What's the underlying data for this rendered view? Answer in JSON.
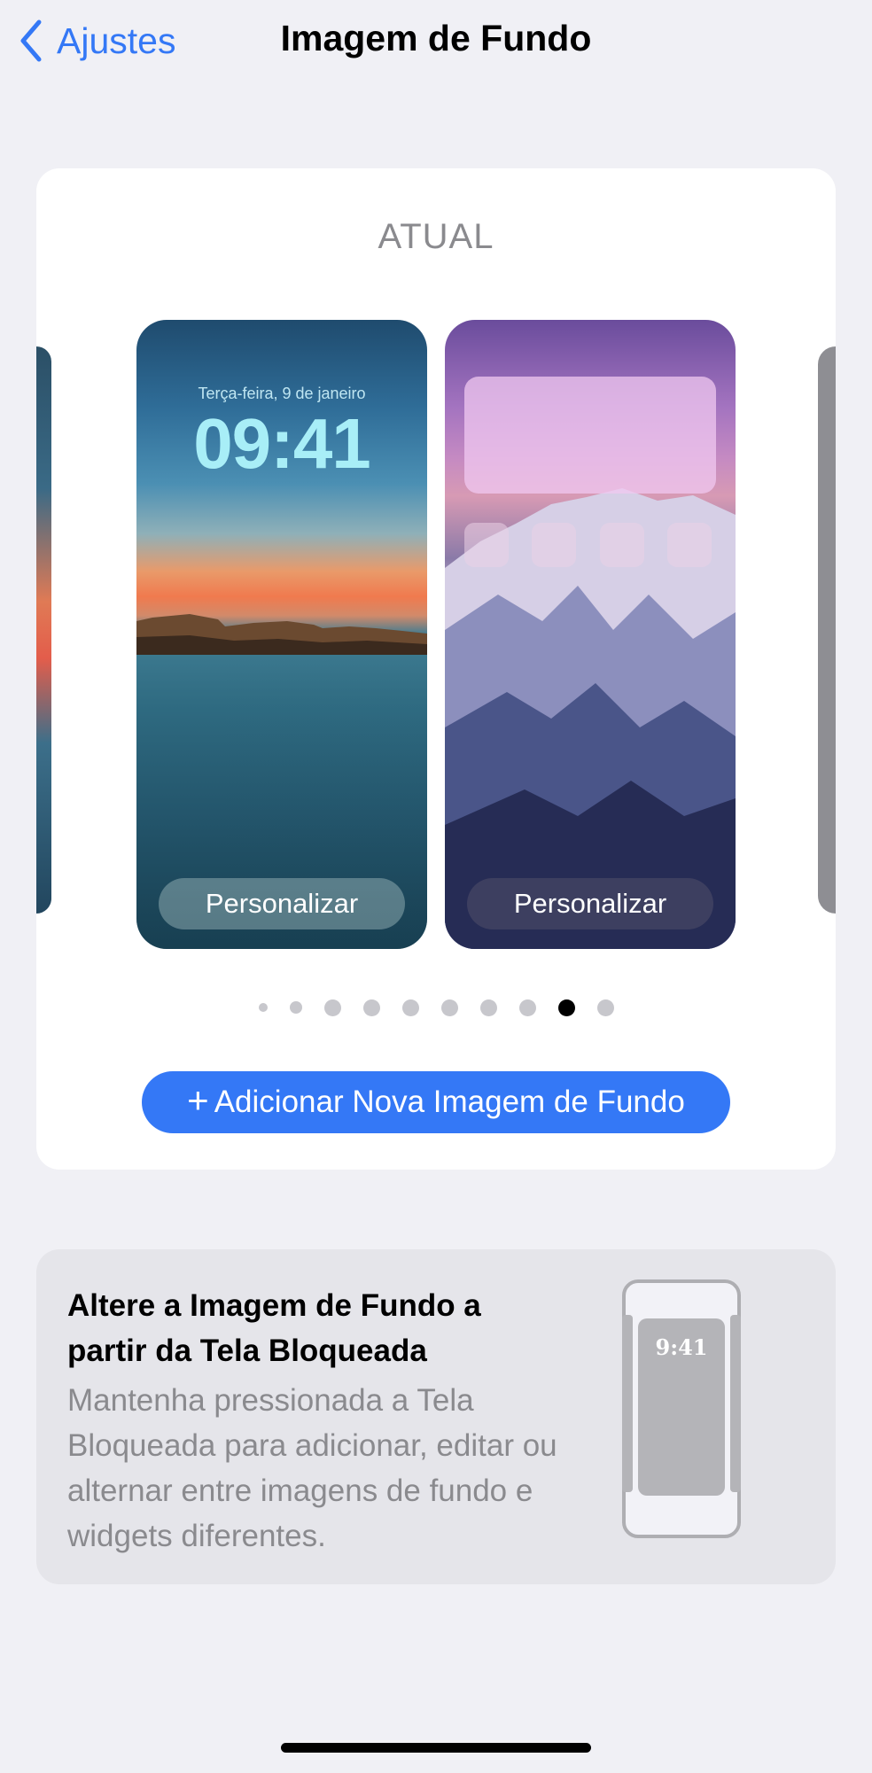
{
  "nav": {
    "back_label": "Ajustes",
    "title": "Imagem de Fundo",
    "back_icon": "chevron-left-icon"
  },
  "current": {
    "label": "ATUAL",
    "lock_screen": {
      "date": "Terça-feira, 9 de janeiro",
      "time": "09:41",
      "button": "Personalizar"
    },
    "home_screen": {
      "button": "Personalizar",
      "app_icon_count": 4
    },
    "pager": {
      "total": 10,
      "active_index": 8
    },
    "add_button": {
      "icon": "+",
      "label": "Adicionar Nova Imagem de Fundo"
    }
  },
  "info": {
    "title": "Altere a Imagem de Fundo a partir da Tela Bloqueada",
    "body": "Mantenha pressionada a Tela Bloqueada para adicionar, editar ou alternar entre imagens de fundo e widgets diferentes.",
    "illustration_time": "9:41"
  },
  "colors": {
    "accent": "#3478f6",
    "background": "#f0f0f5",
    "secondary_text": "#8a8a8e"
  }
}
